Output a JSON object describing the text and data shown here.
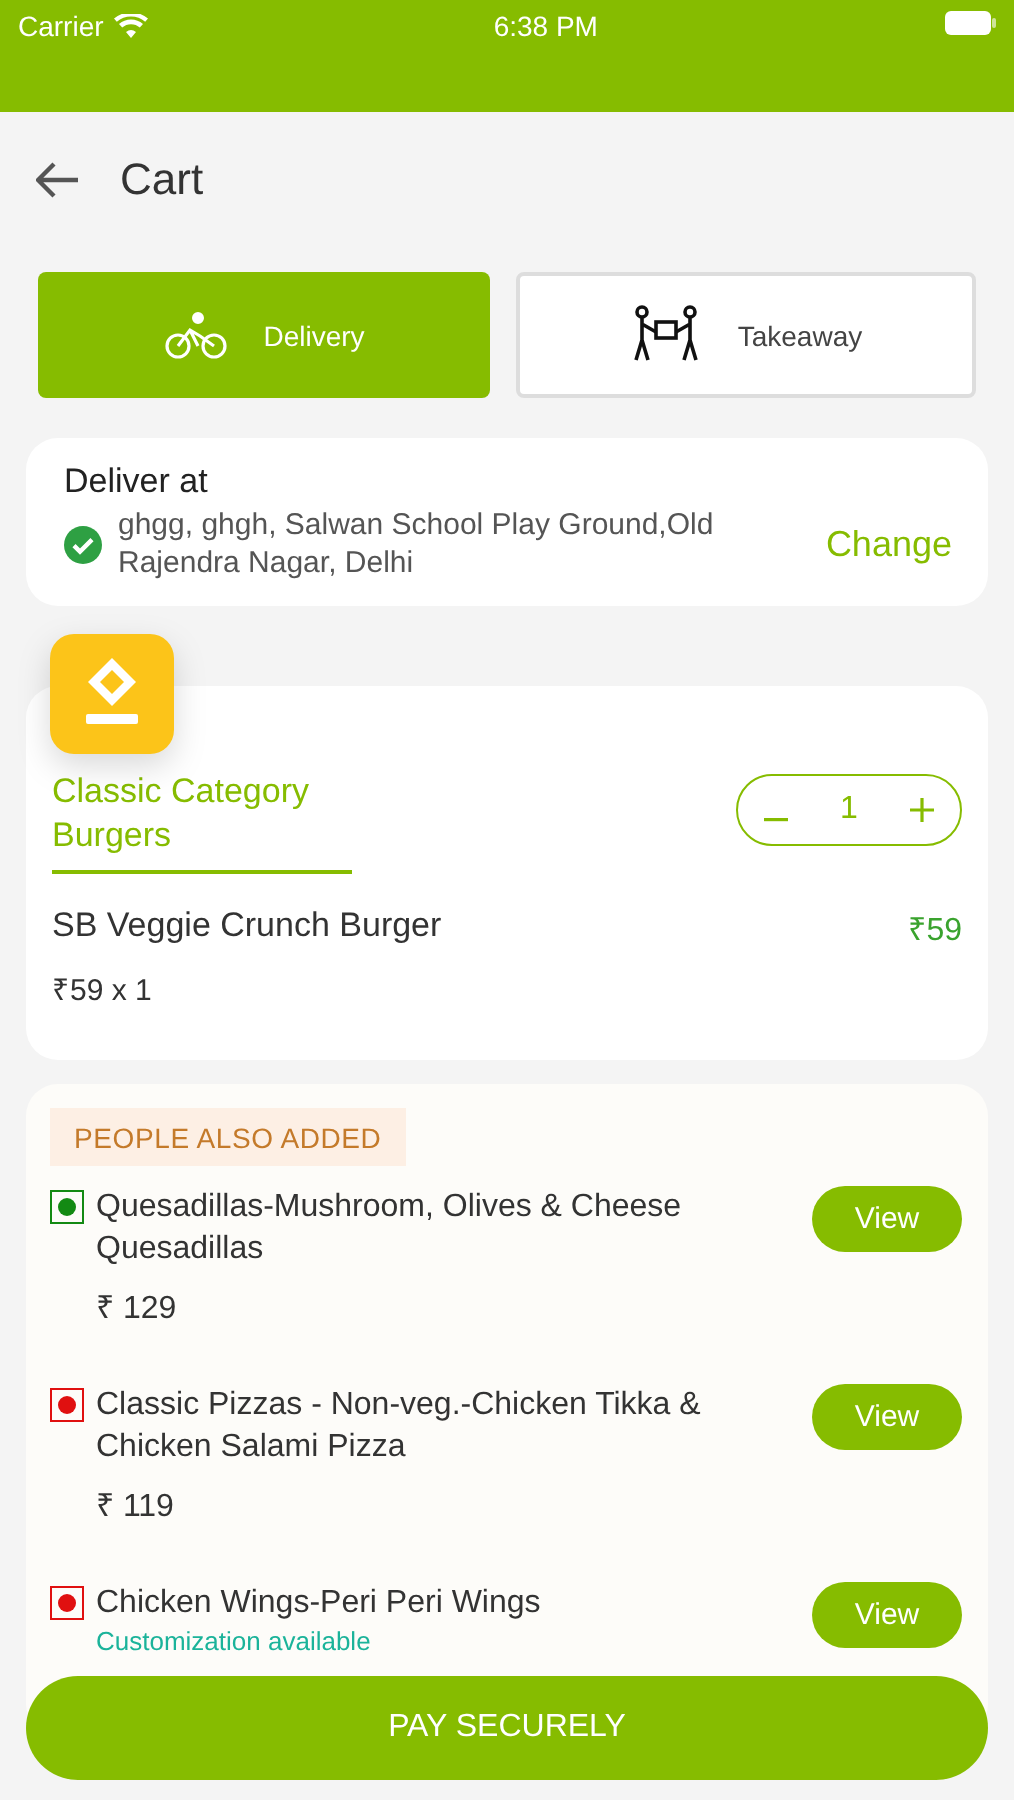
{
  "status_bar": {
    "carrier": "Carrier",
    "time": "6:38 PM"
  },
  "header": {
    "title": "Cart"
  },
  "modes": [
    {
      "kind": "delivery",
      "label": "Delivery",
      "selected": true
    },
    {
      "kind": "takeaway",
      "label": "Takeaway",
      "selected": false
    }
  ],
  "address": {
    "heading": "Deliver at",
    "text": "ghgg, ghgh, Salwan School Play Ground,Old Rajendra Nagar, Delhi",
    "action": "Change"
  },
  "cart": {
    "category": "Classic Category Burgers",
    "quantity": "1",
    "item_name": "SB Veggie Crunch Burger",
    "unit_line": "₹59 x 1",
    "total": "₹59"
  },
  "suggestions": {
    "heading": "PEOPLE ALSO ADDED",
    "items": [
      {
        "name": "Quesadillas-Mushroom, Olives & Cheese Quesadillas",
        "price": "₹ 129",
        "color": "#138a13",
        "button": "View"
      },
      {
        "name": "Classic Pizzas - Non-veg.-Chicken Tikka & Chicken Salami Pizza",
        "price": "₹ 119",
        "color": "#e01010",
        "button": "View"
      },
      {
        "name": "Chicken Wings-Peri Peri Wings",
        "note": "Customization available",
        "color": "#e01010",
        "button": "View"
      }
    ]
  },
  "pay_button": "PAY SECURELY"
}
